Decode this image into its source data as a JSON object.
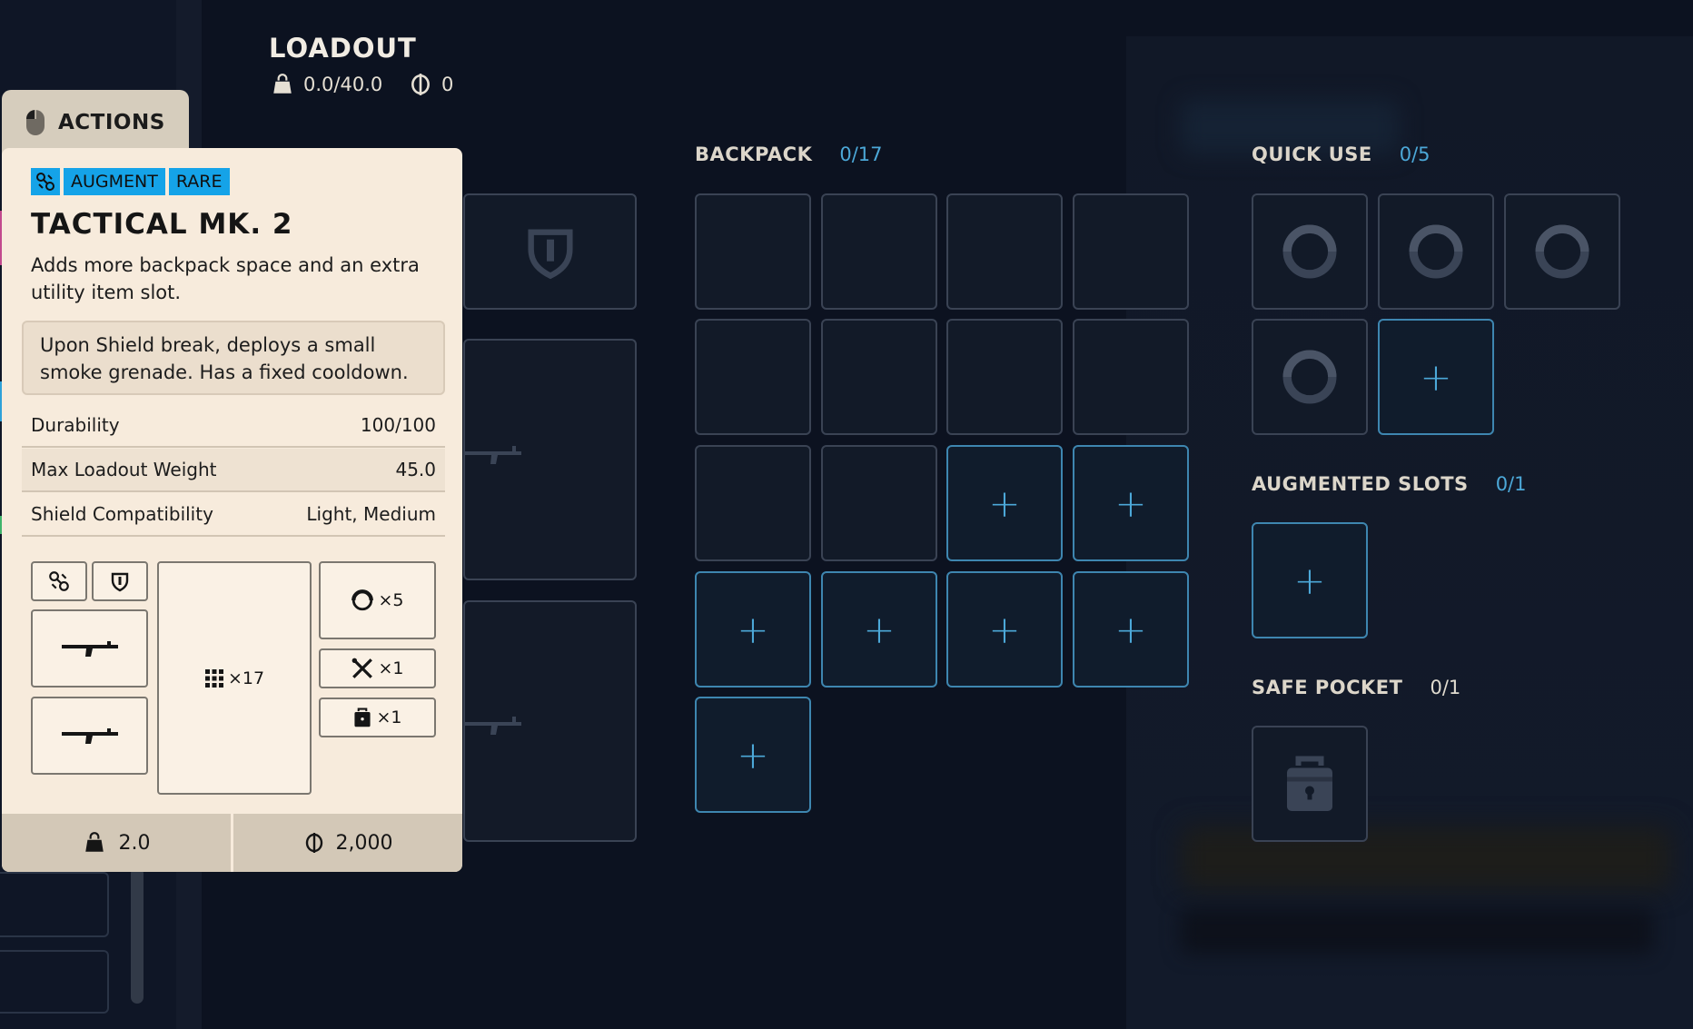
{
  "header": {
    "title": "LOADOUT",
    "weight": "0.0/40.0",
    "credits": "0"
  },
  "actions": {
    "label": "ACTIONS"
  },
  "backpack": {
    "label": "BACKPACK",
    "count": "0/17"
  },
  "quick_use": {
    "label": "QUICK USE",
    "count": "0/5"
  },
  "augmented_slots": {
    "label": "AUGMENTED SLOTS",
    "count": "0/1"
  },
  "safe_pocket": {
    "label": "SAFE POCKET",
    "count": "0/1"
  },
  "tooltip": {
    "tags": [
      "AUGMENT",
      "RARE"
    ],
    "name": "TACTICAL MK. 2",
    "description": "Adds more backpack space and an extra utility item slot.",
    "effect": "Upon Shield break, deploys a small smoke grenade. Has a fixed cooldown.",
    "stats": [
      {
        "label": "Durability",
        "value": "100/100"
      },
      {
        "label": "Max Loadout Weight",
        "value": "45.0"
      },
      {
        "label": "Shield Compatibility",
        "value": "Light, Medium"
      }
    ],
    "layout": {
      "backpack": "×17",
      "quick_use": "×5",
      "utility": "×1",
      "safe_pocket": "×1"
    },
    "footer": {
      "weight": "2.0",
      "price": "2,000"
    }
  },
  "colors": {
    "accent": "#4ca8d8",
    "tag": "#15a3e8",
    "tooltip_bg": "#f7ebdc",
    "background": "#0c1220"
  },
  "icons": {
    "actions": "mouse-icon",
    "weight": "weight-bag-icon",
    "credits": "credits-coin-icon",
    "augment": "augment-icon",
    "shield": "shield-icon",
    "quick_use": "quick-use-ring-icon",
    "utility": "utility-tools-icon",
    "safe_pocket": "safe-lock-icon",
    "backpack": "grid-icon",
    "weapon": "rifle-icon"
  }
}
